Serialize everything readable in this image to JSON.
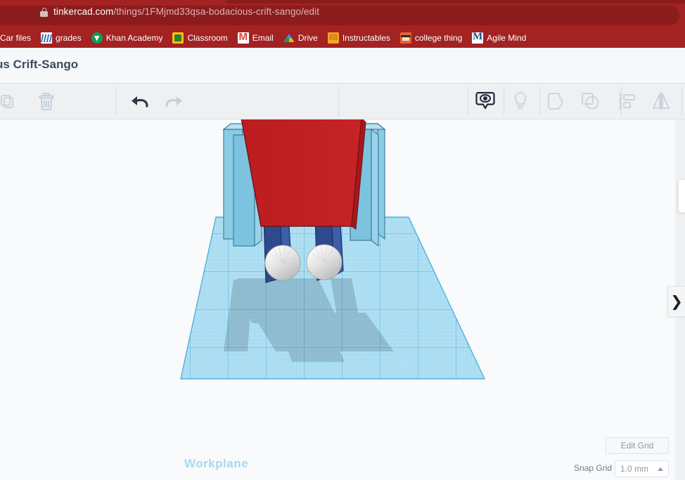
{
  "browser": {
    "url_domain": "tinkercad.com",
    "url_path": "/things/1FMjmd33qsa-bodacious-crift-sango/edit",
    "lock_icon": "lock-icon",
    "bookmarks": [
      {
        "label": "Car files",
        "icon": ""
      },
      {
        "label": "grades",
        "icon": "grades-favicon"
      },
      {
        "label": "Khan Academy",
        "icon": "khan-academy-favicon"
      },
      {
        "label": "Classroom",
        "icon": "google-classroom-favicon"
      },
      {
        "label": "Email",
        "icon": "gmail-favicon"
      },
      {
        "label": "Drive",
        "icon": "google-drive-favicon"
      },
      {
        "label": "Instructables",
        "icon": "instructables-favicon"
      },
      {
        "label": "college thing",
        "icon": "college-thing-favicon"
      },
      {
        "label": "Agile Mind",
        "icon": "agile-mind-favicon"
      }
    ]
  },
  "app": {
    "design_title": "acious Crift-Sango",
    "toolbar": {
      "left_tools": [
        {
          "name": "duplicate-icon",
          "label": "Duplicate",
          "state": "partial"
        },
        {
          "name": "delete-icon",
          "label": "Delete",
          "state": "disabled"
        }
      ],
      "history_tools": [
        {
          "name": "undo-icon",
          "label": "Undo",
          "state": "enabled"
        },
        {
          "name": "redo-icon",
          "label": "Redo",
          "state": "disabled"
        }
      ],
      "right_tools": [
        {
          "name": "show-hide-icon",
          "label": "Show/Hide",
          "state": "active"
        },
        {
          "name": "lightbulb-icon",
          "label": "Hide Others",
          "state": "disabled"
        },
        {
          "name": "group-icon",
          "label": "Group",
          "state": "disabled"
        },
        {
          "name": "ungroup-icon",
          "label": "Ungroup",
          "state": "disabled"
        },
        {
          "name": "align-icon",
          "label": "Align",
          "state": "disabled"
        },
        {
          "name": "mirror-icon",
          "label": "Mirror",
          "state": "disabled"
        }
      ]
    },
    "viewport": {
      "workplane_label": "Workplane",
      "panel_expander_icon": "chevron-right-icon",
      "model": {
        "name": "robot",
        "parts": [
          {
            "name": "body",
            "shape": "box",
            "color": "#c01f22"
          },
          {
            "name": "left-eye",
            "shape": "sphere",
            "color": "#d9d9d9"
          },
          {
            "name": "right-eye",
            "shape": "sphere",
            "color": "#d9d9d9"
          },
          {
            "name": "left-arm",
            "shape": "box",
            "color": "#7cc3e0"
          },
          {
            "name": "right-arm",
            "shape": "box",
            "color": "#7cc3e0"
          },
          {
            "name": "left-leg",
            "shape": "box",
            "color": "#2e4a8c"
          },
          {
            "name": "right-leg",
            "shape": "box",
            "color": "#2e4a8c"
          }
        ]
      },
      "colors": {
        "workplane_fill": "#a9dcf2",
        "workplane_grid": "#3aa8d8",
        "body_red": "#c01f22",
        "arm_blue": "#7cc3e0",
        "leg_blue": "#2e4a8c",
        "eye_grey": "#d9d9d9",
        "canvas_bg": "#f9fafb"
      }
    },
    "grid_controls": {
      "edit_grid_label": "Edit Grid",
      "snap_grid_label": "Snap Grid",
      "snap_grid_value": "1.0 mm",
      "snap_grid_caret": "caret-up-icon"
    }
  }
}
